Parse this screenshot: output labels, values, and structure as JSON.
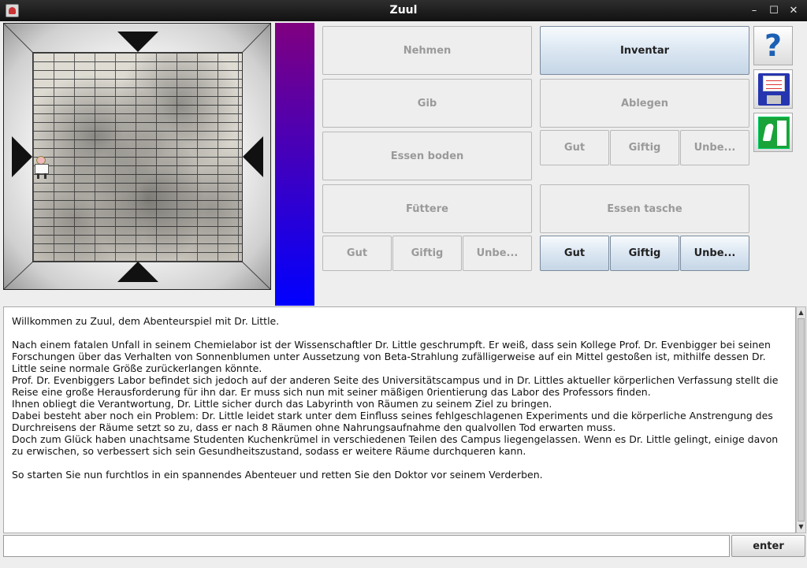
{
  "window": {
    "title": "Zuul",
    "controls": {
      "minimize": "–",
      "maximize": "☐",
      "close": "✕"
    }
  },
  "map": {
    "exits": [
      "north",
      "south",
      "west",
      "east"
    ],
    "player": "dr-little"
  },
  "health_bar": {
    "colors": [
      "#800080",
      "#0000ff"
    ]
  },
  "buttons": {
    "nehmen": "Nehmen",
    "inventar": "Inventar",
    "gib": "Gib",
    "ablegen": "Ablegen",
    "ablegen_gut": "Gut",
    "ablegen_giftig": "Giftig",
    "ablegen_unbe": "Unbe...",
    "essen_boden": "Essen boden",
    "fuettere": "Füttere",
    "essen_tasche": "Essen tasche",
    "fuettere_gut": "Gut",
    "fuettere_giftig": "Giftig",
    "fuettere_unbe": "Unbe...",
    "tasche_gut": "Gut",
    "tasche_giftig": "Giftig",
    "tasche_unbe": "Unbe..."
  },
  "side_icons": [
    "help-icon",
    "save-icon",
    "exit-icon"
  ],
  "help_glyph": "?",
  "output": {
    "lines": [
      "Willkommen zu Zuul, dem Abenteurspiel mit Dr. Little.",
      "",
      "Nach einem fatalen Unfall in seinem Chemielabor ist der Wissenschaftler Dr. Little geschrumpft. Er weiß, dass sein Kollege Prof. Dr. Evenbigger bei seinen",
      "Forschungen über das Verhalten von Sonnenblumen unter Aussetzung von Beta-Strahlung zufälligerweise auf ein Mittel gestoßen ist, mithilfe dessen Dr.",
      "Little seine normale Größe zurückerlangen könnte.",
      "Prof. Dr. Evenbiggers Labor befindet sich jedoch auf der anderen Seite des Universitätscampus und in Dr. Littles aktueller körperlichen Verfassung stellt die",
      "Reise eine große Herausforderung für ihn dar. Er muss sich nun mit seiner mäßigen 0rientierung das Labor des Professors finden.",
      "Ihnen obliegt die Verantwortung, Dr. Little sicher durch das Labyrinth von Räumen zu seinem Ziel zu bringen.",
      "Dabei besteht aber noch ein Problem: Dr. Little leidet stark unter dem Einfluss seines fehlgeschlagenen Experiments und die körperliche Anstrengung des",
      "Durchreisens der Räume setzt so zu, dass er nach 8 Räumen ohne Nahrungsaufnahme den qualvollen Tod erwarten muss.",
      "Doch zum Glück haben unachtsame Studenten Kuchenkrümel in verschiedenen Teilen des Campus liegengelassen. Wenn es Dr. Little gelingt, einige davon",
      "zu erwischen, so verbessert sich sein Gesundheitszustand, sodass er weitere Räume durchqueren kann.",
      "",
      "So starten Sie nun furchtlos in ein spannendes Abenteuer und retten Sie den Doktor vor seinem Verderben."
    ]
  },
  "command_input": {
    "value": ""
  },
  "enter_label": "enter"
}
